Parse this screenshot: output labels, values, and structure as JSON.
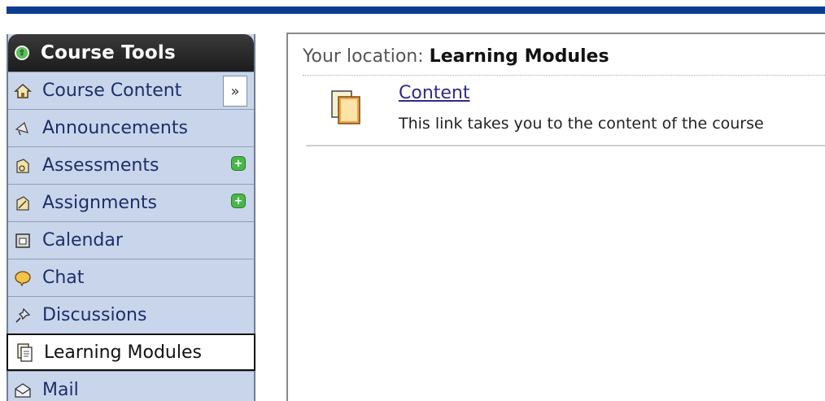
{
  "sidebar": {
    "title": "Course Tools",
    "items": [
      {
        "label": "Course Content",
        "icon": "home-icon"
      },
      {
        "label": "Announcements",
        "icon": "megaphone-icon"
      },
      {
        "label": "Assessments",
        "icon": "assessment-icon"
      },
      {
        "label": "Assignments",
        "icon": "assignment-icon"
      },
      {
        "label": "Calendar",
        "icon": "calendar-icon"
      },
      {
        "label": "Chat",
        "icon": "chat-icon"
      },
      {
        "label": "Discussions",
        "icon": "pushpin-icon"
      },
      {
        "label": "Learning Modules",
        "icon": "learning-modules-icon"
      },
      {
        "label": "Mail",
        "icon": "mail-icon"
      }
    ]
  },
  "main": {
    "location_prefix": "Your location:",
    "location_current": "Learning Modules",
    "items": [
      {
        "title": "Content",
        "description": "This link takes you to the content of the course"
      }
    ]
  },
  "colors": {
    "top_bar": "#0a3d91",
    "sidebar_bg": "#c9d5ea",
    "link": "#2e2a8a",
    "badge": "#49b649"
  }
}
